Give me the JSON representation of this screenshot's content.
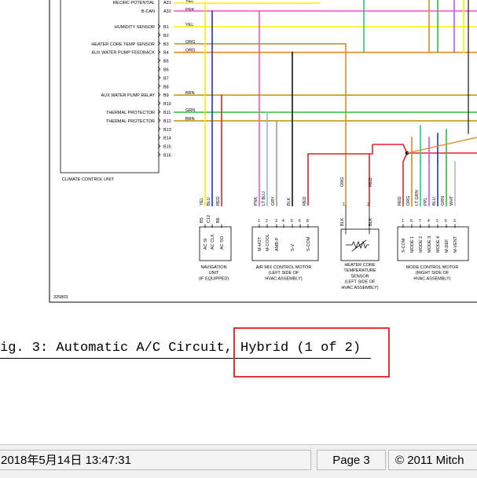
{
  "unit": {
    "top_labels": [
      "RECIRC POTENTIAL",
      "B-CAN"
    ],
    "top_pins": [
      "A31",
      "A32"
    ],
    "top_colors": [
      "YEL",
      "PNK"
    ],
    "pins": [
      "B1",
      "B2",
      "B3",
      "B4",
      "B5",
      "B6",
      "B7",
      "B8",
      "B9",
      "B10",
      "B11",
      "B12",
      "B13",
      "B14",
      "B15",
      "B16"
    ],
    "labels": [
      "HUMIDITY SENSOR",
      "",
      "HEATER CORE TEMP SENSOR",
      "AUX WATER PUMP FEEDBACK",
      "",
      "",
      "",
      "",
      "AUX WATER PUMP RELAY",
      "",
      "THERMAL PROTECTOR",
      "THERMAL PROTECTOR",
      "",
      "",
      "",
      ""
    ],
    "colors": [
      "YEL",
      "",
      "ORG",
      "ORG",
      "",
      "",
      "",
      "",
      "BRN",
      "",
      "GRN",
      "BRN",
      "",
      "",
      "",
      ""
    ],
    "name": "CLIMATE CONTROL UNIT"
  },
  "nav": {
    "wires": [
      "YEL",
      "BLU",
      "RED"
    ],
    "pins": [
      "B5",
      "C12",
      "B6"
    ],
    "signals": [
      "AC SI",
      "AC CLK",
      "AC SO"
    ],
    "title": [
      "NAVIGATION",
      "UNIT",
      "(IF EQUIPPED)"
    ]
  },
  "airmix": {
    "wires": [
      "PNK",
      "LT BLU",
      "GRY",
      "BLK",
      "RED"
    ],
    "pins": [
      "1",
      "2",
      "3",
      "4",
      "5",
      "6",
      "8"
    ],
    "signals": [
      "M-HOT",
      "M-COOL",
      "AMB-P",
      "",
      "S-V",
      "",
      "S-COM"
    ],
    "title": [
      "AIR MIX CONTROL MOTOR",
      "(LEFT SIDE OF",
      "HVAC ASSEMBLY)"
    ]
  },
  "heater": {
    "wires": [
      "ORG",
      "RED"
    ],
    "wires_lower": [
      "BLK",
      "BLK"
    ],
    "pins": [
      "1",
      "2"
    ],
    "title": [
      "HEATER CORE",
      "TEMPERATURE",
      "SENSOR",
      "(LEFT SIDE OF",
      "HVAC ASSEMBLY)"
    ]
  },
  "mode": {
    "wires": [
      "RED",
      "ORG",
      "LT GRN",
      "PPL",
      "BLU",
      "GRN",
      "WHT"
    ],
    "pins": [
      "1",
      "5",
      "7",
      "4",
      "2",
      "6",
      "3"
    ],
    "signals": [
      "S-COM",
      "MODE 1",
      "MODE 2",
      "MODE 3",
      "MODE 4",
      "M-DEF",
      "M-VENT"
    ],
    "title": [
      "MODE CONTROL MOTOR",
      "(RIGHT SIDE OF",
      "HVAC ASSEMBLY)"
    ]
  },
  "figure_number": "325803",
  "caption": "ig. 3: Automatic A/C Circuit, Hybrid (1 of 2)",
  "status_bar": {
    "datetime": "2018年5月14日  13:47:31",
    "page": "Page 3",
    "copyright": "© 2011 Mitch"
  },
  "colors": {
    "yel": "#ffee00",
    "pnk": "#ff4fc4",
    "org": "#e0892a",
    "brn": "#c89a10",
    "grn": "#2ec23a",
    "blu": "#1a34c8",
    "red": "#e8222a",
    "gry": "#9a9a9a",
    "ltblu": "#8fb4ff",
    "ltgrn": "#22d06e",
    "ppl": "#c056ff",
    "blk": "#111111",
    "callout": "#e8322f"
  }
}
